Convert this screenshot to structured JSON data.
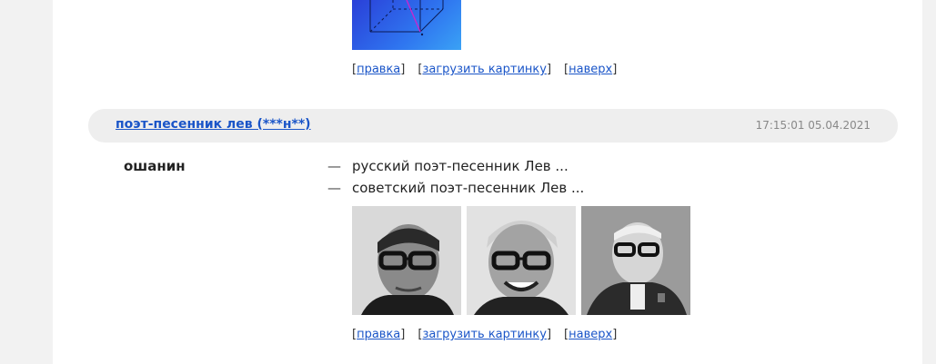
{
  "top_block": {
    "links": {
      "edit": "правка",
      "upload": "загрузить картинку",
      "top": "наверх"
    }
  },
  "entry": {
    "header_link": "поэт-песенник лев (***н**)",
    "timestamp": "17:15:01 05.04.2021",
    "answer": "ошанин",
    "clues": [
      {
        "dash": "—",
        "text": "русский поэт-песенник Лев ..."
      },
      {
        "dash": "—",
        "text": "советский поэт-песенник Лев ..."
      }
    ],
    "links": {
      "edit": "правка",
      "upload": "загрузить картинку",
      "top": "наверх"
    }
  },
  "colors": {
    "link": "#1a55c8",
    "header_bg": "#eeeeee",
    "side_bg": "#f2f2f2"
  }
}
